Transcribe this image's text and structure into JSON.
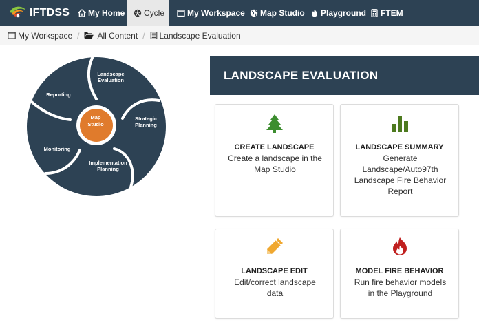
{
  "navbar": {
    "brand": "IFTDSS",
    "items": [
      {
        "label": "My Home",
        "icon": "home-icon"
      },
      {
        "label": "Cycle",
        "icon": "cycle-icon"
      },
      {
        "label": "My Workspace",
        "icon": "window-icon"
      },
      {
        "label": "Map Studio",
        "icon": "globe-icon"
      },
      {
        "label": "Playground",
        "icon": "fire-icon"
      },
      {
        "label": "FTEM",
        "icon": "calculator-icon"
      }
    ]
  },
  "breadcrumb": [
    {
      "label": "My Workspace",
      "icon": "window-icon"
    },
    {
      "label": "All Content",
      "icon": "folder-open-icon"
    },
    {
      "label": "Landscape Evaluation",
      "icon": "document-icon"
    }
  ],
  "cycle": {
    "segments": [
      "Landscape Evaluation",
      "Strategic Planning",
      "Implementation Planning",
      "Monitoring",
      "Reporting"
    ],
    "center": "Map Studio",
    "colors": {
      "segment": "#2d4254",
      "center": "#e07b2c"
    }
  },
  "page": {
    "title": "LANDSCAPE EVALUATION"
  },
  "cards": [
    {
      "title": "CREATE LANDSCAPE",
      "description": "Create a landscape in the Map Studio",
      "icon": "tree-icon",
      "color": "#3c8d2f"
    },
    {
      "title": "LANDSCAPE SUMMARY",
      "description": "Generate Landscape/Auto97th Landscape Fire Behavior Report",
      "icon": "bar-chart-icon",
      "color": "#4d7a1f"
    },
    {
      "title": "LANDSCAPE EDIT",
      "description": "Edit/correct landscape data",
      "icon": "pencil-icon",
      "color": "#f0a830"
    },
    {
      "title": "MODEL FIRE BEHAVIOR",
      "description": "Run fire behavior models in the Playground",
      "icon": "fire-icon",
      "color": "#c0201f"
    }
  ]
}
